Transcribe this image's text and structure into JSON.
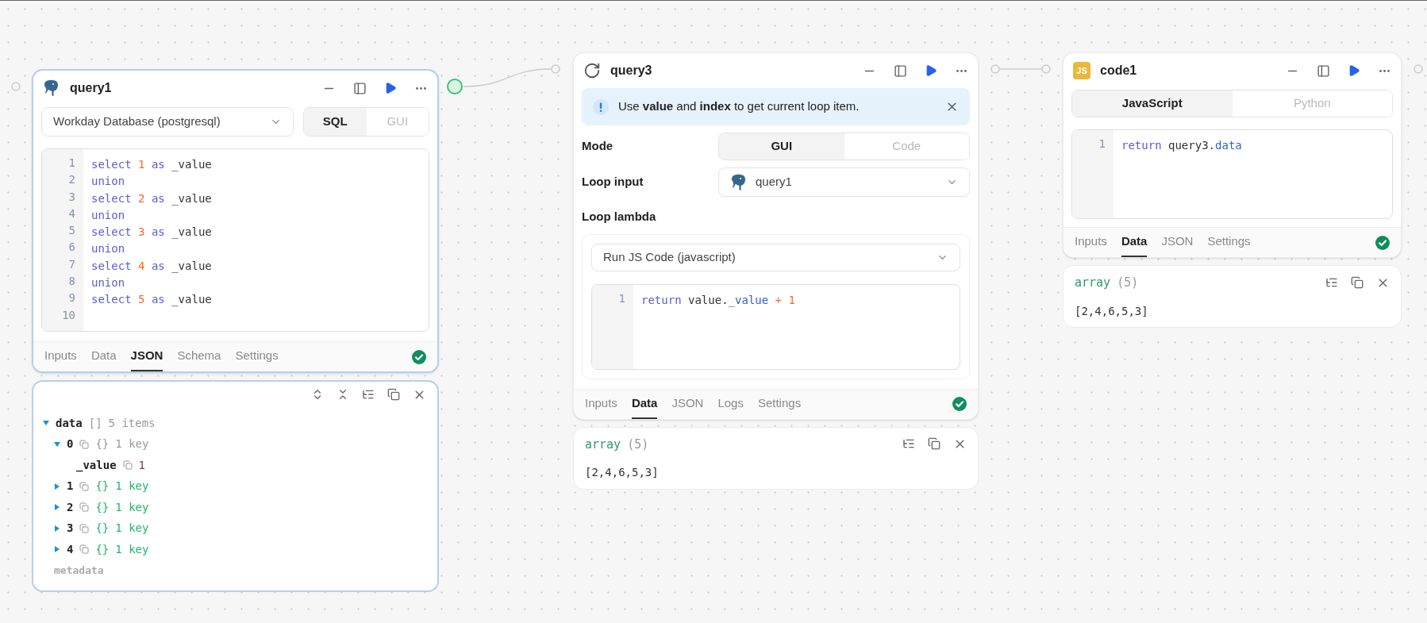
{
  "nodes": [
    {
      "kind": "sql",
      "title": "query1",
      "selected": true,
      "resource": "Workday Database (postgresql)",
      "modes": [
        {
          "label": "SQL",
          "selected": true
        },
        {
          "label": "GUI",
          "selected": false
        }
      ],
      "code": [
        {
          "number": "1",
          "tokens": [
            {
              "kind": "keyword",
              "text": "select "
            },
            {
              "kind": "number",
              "text": "1 "
            },
            {
              "kind": "keyword",
              "text": "as "
            },
            {
              "kind": "plain",
              "text": "_value"
            }
          ]
        },
        {
          "number": "2",
          "tokens": [
            {
              "kind": "keyword",
              "text": "union"
            }
          ]
        },
        {
          "number": "3",
          "tokens": [
            {
              "kind": "keyword",
              "text": "select "
            },
            {
              "kind": "number",
              "text": "2 "
            },
            {
              "kind": "keyword",
              "text": "as "
            },
            {
              "kind": "plain",
              "text": "_value"
            }
          ]
        },
        {
          "number": "4",
          "tokens": [
            {
              "kind": "keyword",
              "text": "union"
            }
          ]
        },
        {
          "number": "5",
          "tokens": [
            {
              "kind": "keyword",
              "text": "select "
            },
            {
              "kind": "number",
              "text": "3 "
            },
            {
              "kind": "keyword",
              "text": "as "
            },
            {
              "kind": "plain",
              "text": "_value"
            }
          ]
        },
        {
          "number": "6",
          "tokens": [
            {
              "kind": "keyword",
              "text": "union"
            }
          ]
        },
        {
          "number": "7",
          "tokens": [
            {
              "kind": "keyword",
              "text": "select "
            },
            {
              "kind": "number",
              "text": "4 "
            },
            {
              "kind": "keyword",
              "text": "as "
            },
            {
              "kind": "plain",
              "text": "_value"
            }
          ]
        },
        {
          "number": "8",
          "tokens": [
            {
              "kind": "keyword",
              "text": "union"
            }
          ]
        },
        {
          "number": "9",
          "tokens": [
            {
              "kind": "keyword",
              "text": "select "
            },
            {
              "kind": "number",
              "text": "5 "
            },
            {
              "kind": "keyword",
              "text": "as "
            },
            {
              "kind": "plain",
              "text": "_value"
            }
          ]
        },
        {
          "number": "10"
        }
      ],
      "tabs": [
        {
          "label": "Inputs",
          "selected": false
        },
        {
          "label": "Data",
          "selected": false
        },
        {
          "label": "JSON",
          "selected": true
        },
        {
          "label": "Schema",
          "selected": false
        },
        {
          "label": "Settings",
          "selected": false
        }
      ],
      "succeeded": true,
      "result": {
        "kind": "tree",
        "tree": [
          {
            "key": "data",
            "type": "[]",
            "summary": "5 items",
            "expanded": true,
            "children": [
              {
                "key": "0",
                "type": "{}",
                "summary": "1 key",
                "expanded": true,
                "children": [
                  {
                    "key": "_value",
                    "value": "1"
                  }
                ]
              },
              {
                "key": "1",
                "type": "{}",
                "summary": "1 key",
                "expanded": false
              },
              {
                "key": "2",
                "type": "{}",
                "summary": "1 key",
                "expanded": false
              },
              {
                "key": "3",
                "type": "{}",
                "summary": "1 key",
                "expanded": false
              },
              {
                "key": "4",
                "type": "{}",
                "summary": "1 key",
                "expanded": false
              }
            ]
          }
        ],
        "footer": "metadata"
      }
    },
    {
      "kind": "loop",
      "title": "query3",
      "selected": false,
      "alert": "Use **value** and **index** to get current loop item.",
      "fields": [
        {
          "kind": "segmented",
          "label": "Mode",
          "options": [
            {
              "label": "GUI",
              "selected": true
            },
            {
              "label": "Code",
              "selected": false
            }
          ]
        },
        {
          "kind": "select",
          "label": "Loop input",
          "value": "query1"
        }
      ],
      "lambda_label": "Loop lambda",
      "lambda": {
        "runner": "Run JS Code (javascript)",
        "code": [
          {
            "number": "1",
            "tokens": [
              {
                "kind": "keyword",
                "text": "return "
              },
              {
                "kind": "plain",
                "text": "value."
              },
              {
                "kind": "property",
                "text": "_value"
              },
              {
                "kind": "number",
                "text": " + 1"
              }
            ]
          }
        ]
      },
      "tabs": [
        {
          "label": "Inputs",
          "selected": false
        },
        {
          "label": "Data",
          "selected": true
        },
        {
          "label": "JSON",
          "selected": false
        },
        {
          "label": "Logs",
          "selected": false
        },
        {
          "label": "Settings",
          "selected": false
        }
      ],
      "succeeded": true,
      "result": {
        "kind": "array",
        "type_label": "array",
        "count": "(5)",
        "value": "[2,4,6,5,3]"
      }
    },
    {
      "kind": "code",
      "title": "code1",
      "selected": false,
      "badge": "JS",
      "modes": [
        {
          "label": "JavaScript",
          "selected": true
        },
        {
          "label": "Python",
          "selected": false
        }
      ],
      "code": [
        {
          "number": "1",
          "tokens": [
            {
              "kind": "keyword",
              "text": "return "
            },
            {
              "kind": "plain",
              "text": "query3."
            },
            {
              "kind": "property",
              "text": "data"
            }
          ]
        }
      ],
      "tabs": [
        {
          "label": "Inputs",
          "selected": false
        },
        {
          "label": "Data",
          "selected": true
        },
        {
          "label": "JSON",
          "selected": false
        },
        {
          "label": "Settings",
          "selected": false
        }
      ],
      "succeeded": true,
      "result": {
        "kind": "array",
        "type_label": "array",
        "count": "(5)",
        "value": "[2,4,6,5,3]"
      }
    }
  ]
}
